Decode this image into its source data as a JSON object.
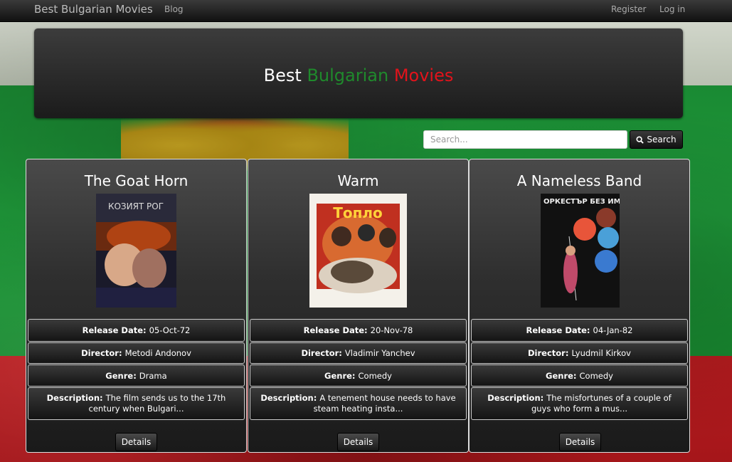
{
  "nav": {
    "brand": "Best Bulgarian Movies",
    "blog": "Blog",
    "register": "Register",
    "login": "Log in"
  },
  "jumbotron": {
    "word1": "Best",
    "word2": "Bulgarian",
    "word3": "Movies",
    "colors": {
      "word1": "#ffffff",
      "word2": "#1f8a2c",
      "word3": "#e2131b"
    }
  },
  "search": {
    "placeholder": "Search...",
    "button_label": "Search",
    "icon": "search-icon"
  },
  "labels": {
    "release": "Release Date:",
    "director": "Director:",
    "genre": "Genre:",
    "description": "Description:",
    "details": "Details"
  },
  "movies": [
    {
      "title": "The Goat Horn",
      "release": "05-Oct-72",
      "director": "Metodi Andonov",
      "genre": "Drama",
      "description": "The film sends us to the 17th century when Bulgari...",
      "poster": {
        "caption": "КОЗИЯТ РОГ"
      }
    },
    {
      "title": "Warm",
      "release": "20-Nov-78",
      "director": "Vladimir Yanchev",
      "genre": "Comedy",
      "description": "A tenement house needs to have steam heating insta...",
      "poster": {
        "caption": "Топло"
      }
    },
    {
      "title": "A Nameless Band",
      "release": "04-Jan-82",
      "director": "Lyudmil Kirkov",
      "genre": "Comedy",
      "description": "The misfortunes of a couple of guys who form a mus...",
      "poster": {
        "caption": "ОРКЕСТЪР БЕЗ ИМЕ"
      }
    }
  ]
}
